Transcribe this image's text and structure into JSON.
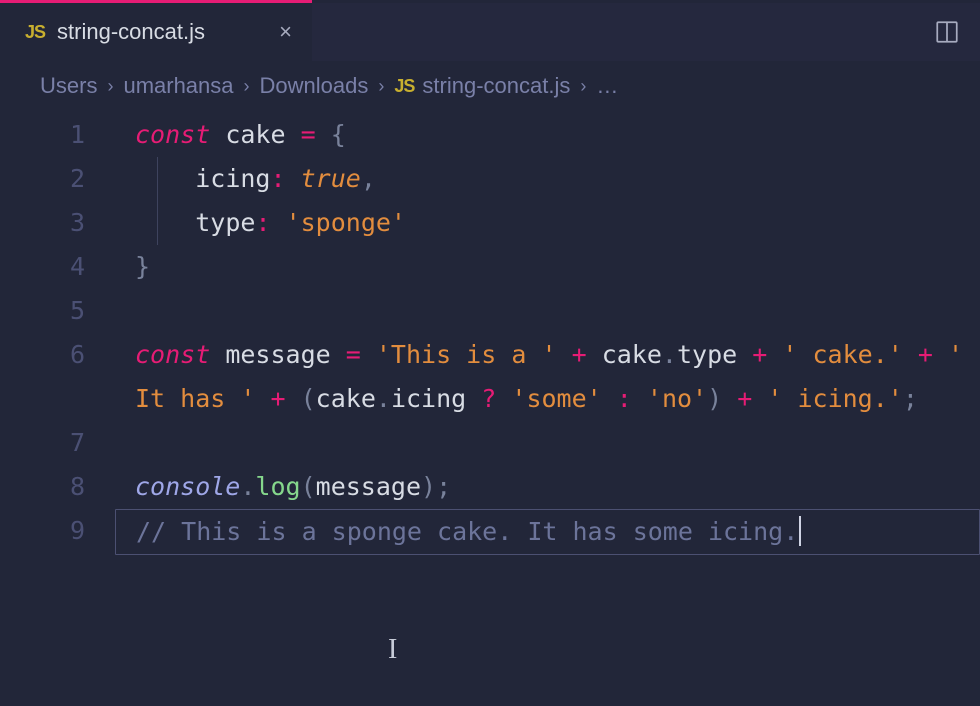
{
  "tab": {
    "icon": "JS",
    "title": "string-concat.js",
    "close": "×"
  },
  "breadcrumbs": {
    "parts": [
      "Users",
      "umarhansa",
      "Downloads"
    ],
    "file_icon": "JS",
    "file_name": "string-concat.js",
    "ellipsis": "…"
  },
  "editor": {
    "lines": [
      "1",
      "2",
      "3",
      "4",
      "5",
      "6",
      "7",
      "8",
      "9"
    ]
  },
  "code": {
    "l1": {
      "kw": "const",
      "sp1": " ",
      "id": "cake",
      "sp2": " ",
      "eq": "=",
      "sp3": " ",
      "brace": "{"
    },
    "l2": {
      "indent": "    ",
      "prop": "icing",
      "colon": ":",
      "sp": " ",
      "val": "true",
      "comma": ","
    },
    "l3": {
      "indent": "    ",
      "prop": "type",
      "colon": ":",
      "sp": " ",
      "val": "'sponge'"
    },
    "l4": {
      "brace": "}"
    },
    "l6a": {
      "kw": "const",
      "sp1": " ",
      "id": "message",
      "sp2": " ",
      "eq": "=",
      "sp3": " ",
      "s1": "'This is a '",
      "sp4": " ",
      "plus1": "+",
      "sp5": " ",
      "cake": "cake",
      "dot1": ".",
      "type": "type",
      "sp6": " ",
      "plus2": "+",
      "sp7": " ",
      "s2": "' "
    },
    "l6b": {
      "s2b": "cake.'",
      "sp1": " ",
      "plus3": "+",
      "sp2": " ",
      "s3": "' It has '",
      "sp3": " ",
      "plus4": "+",
      "sp4": " ",
      "lparen": "(",
      "cake2": "cake",
      "dot2": ".",
      "icing": "icing",
      "sp5": " ",
      "tern1": "?",
      "sp6": " ",
      "s4": "'some'",
      "sp7": " ",
      "tern2": ":",
      "sp8": " "
    },
    "l6c": {
      "s5": "'no'",
      "rparen": ")",
      "sp1": " ",
      "plus5": "+",
      "sp2": " ",
      "s6": "' icing.'",
      "semi": ";"
    },
    "l8": {
      "console": "console",
      "dot": ".",
      "log": "log",
      "lparen": "(",
      "msg": "message",
      "rparen": ")",
      "semi": ";"
    },
    "l9": {
      "comment": "// This is a sponge cake. It has some icing."
    }
  }
}
